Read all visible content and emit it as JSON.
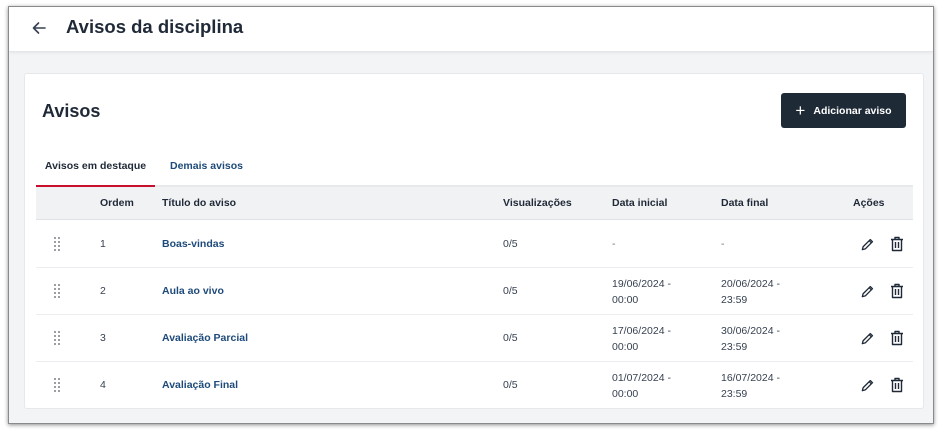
{
  "header": {
    "back_icon": "arrow-left-icon",
    "title": "Avisos da disciplina"
  },
  "section": {
    "title": "Avisos",
    "add_button_icon": "plus-icon",
    "add_button_label": "Adicionar aviso"
  },
  "tabs": [
    {
      "label": "Avisos em destaque",
      "active": true
    },
    {
      "label": "Demais avisos",
      "active": false
    }
  ],
  "table": {
    "columns": {
      "order": "Ordem",
      "title": "Título do aviso",
      "views": "Visualizações",
      "start": "Data inicial",
      "end": "Data final",
      "actions": "Ações"
    },
    "rows": [
      {
        "order": "1",
        "title": "Boas-vindas",
        "views": "0/5",
        "start_line1": "-",
        "start_line2": "",
        "end_line1": "-",
        "end_line2": ""
      },
      {
        "order": "2",
        "title": "Aula ao vivo",
        "views": "0/5",
        "start_line1": "19/06/2024 -",
        "start_line2": "00:00",
        "end_line1": "20/06/2024 -",
        "end_line2": "23:59"
      },
      {
        "order": "3",
        "title": "Avaliação Parcial",
        "views": "0/5",
        "start_line1": "17/06/2024 -",
        "start_line2": "00:00",
        "end_line1": "30/06/2024 -",
        "end_line2": "23:59"
      },
      {
        "order": "4",
        "title": "Avaliação Final",
        "views": "0/5",
        "start_line1": "01/07/2024 -",
        "start_line2": "00:00",
        "end_line1": "16/07/2024 -",
        "end_line2": "23:59"
      }
    ],
    "row_icons": {
      "drag": "drag-handle-icon",
      "edit": "pencil-icon",
      "delete": "trash-icon"
    }
  },
  "colors": {
    "accent_tab": "#c8102e",
    "primary_button": "#1f2a37",
    "link": "#1d4a7a"
  }
}
